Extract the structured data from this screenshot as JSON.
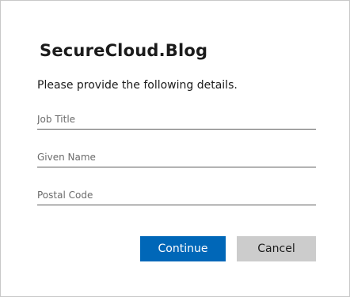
{
  "header": {
    "logo_text": "SecureCloud.Blog"
  },
  "form": {
    "intro": "Please provide the following details.",
    "job_title": {
      "placeholder": "Job Title",
      "value": ""
    },
    "given_name": {
      "placeholder": "Given Name",
      "value": ""
    },
    "postal_code": {
      "placeholder": "Postal Code",
      "value": ""
    }
  },
  "actions": {
    "continue_label": "Continue",
    "cancel_label": "Cancel"
  },
  "colors": {
    "primary_button": "#0067b8",
    "secondary_button": "#cccccc"
  }
}
